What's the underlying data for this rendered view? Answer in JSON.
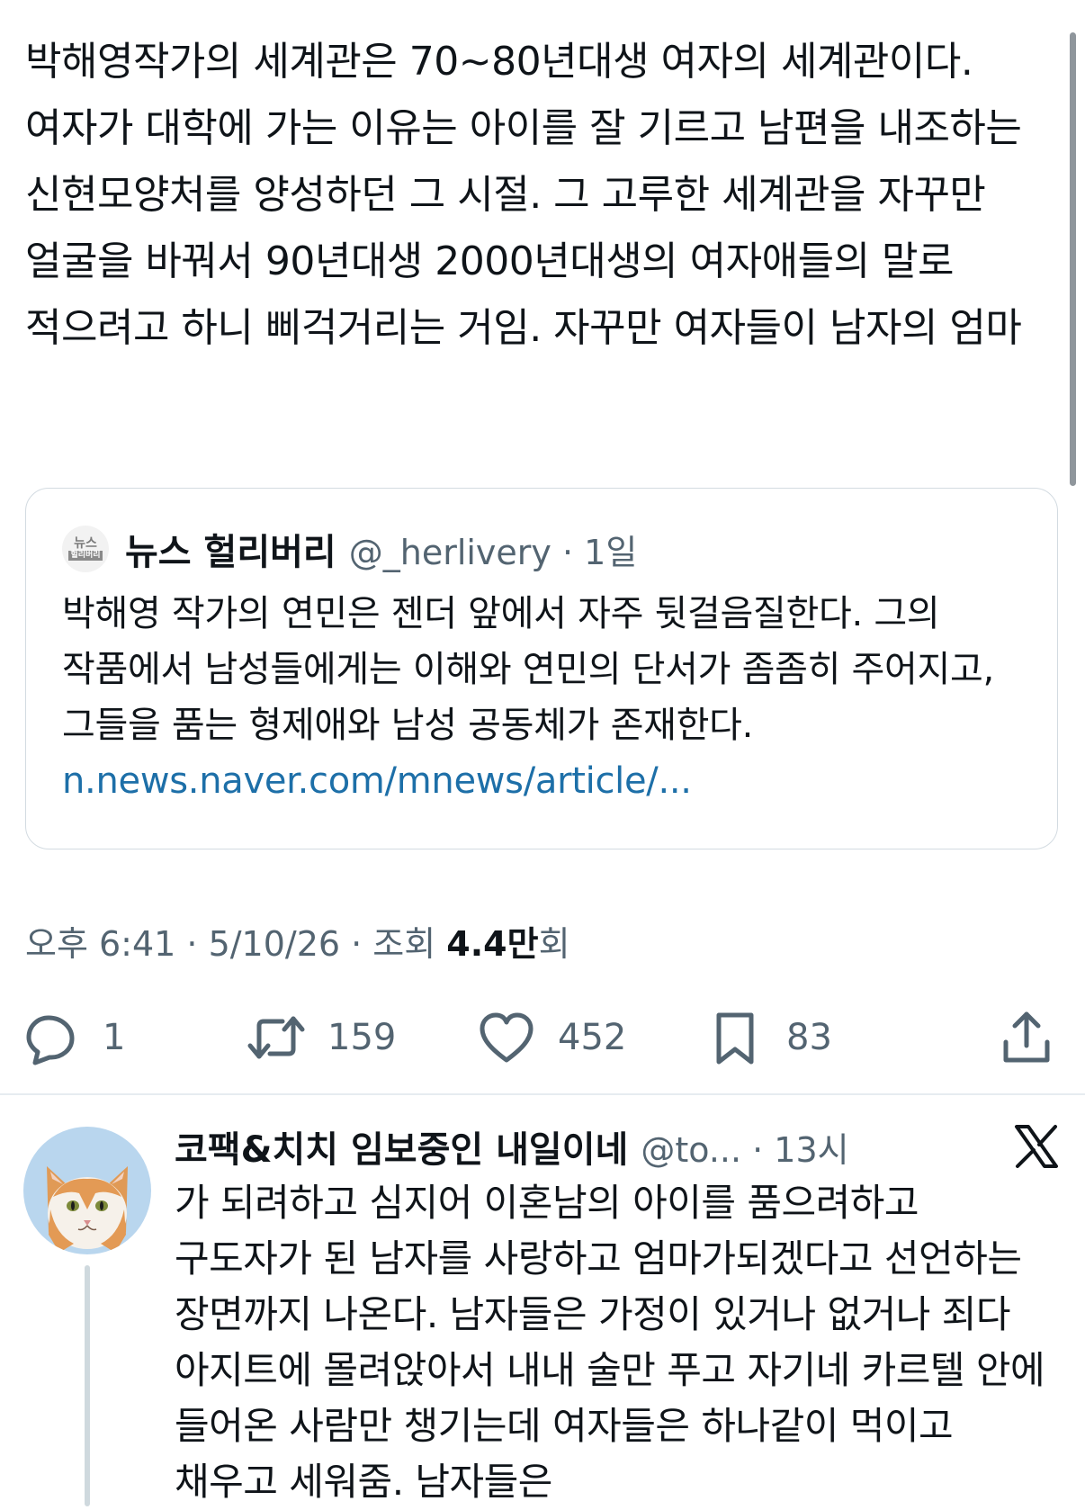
{
  "tweet": {
    "text": "박해영작가의 세계관은 70~80년대생 여자의 세계관이다. 여자가 대학에 가는 이유는 아이를 잘 기르고 남편을 내조하는 신현모양처를 양성하던 그 시절. 그 고루한 세계관을 자꾸만 얼굴을 바꿔서 90년대생 2000년대생의 여자애들의 말로 적으려고 하니 삐걱거리는 거임. 자꾸만 여자들이 남자의 엄마",
    "timestamp": "오후 6:41 · 5/10/26 · 조회 ",
    "views_count": "4.4만",
    "views_suffix": "회"
  },
  "quote": {
    "avatar_text_top": "뉴스",
    "avatar_text_mid": "헐리버리",
    "author_name": "뉴스 헐리버리",
    "handle_time": "@_herlivery · 1일",
    "body": "박해영 작가의 연민은 젠더 앞에서 자주 뒷걸음질한다. 그의 작품에서 남성들에게는 이해와 연민의 단서가 좀좀히 주어지고, 그들을 품는 형제애와 남성 공동체가 존재한다.",
    "link": "n.news.naver.com/mnews/article/..."
  },
  "actions": {
    "reply_count": "1",
    "retweet_count": "159",
    "like_count": "452",
    "bookmark_count": "83"
  },
  "reply": {
    "author_name": "코팩&치치 임보중인 내일이네",
    "handle_time": "@to... · 13시",
    "text": "가 되려하고 심지어 이혼남의 아이를 품으려하고 구도자가 된 남자를 사랑하고 엄마가되겠다고 선언하는 장면까지 나온다. 남자들은 가정이 있거나 없거나 죄다 아지트에 몰려앉아서 내내 술만 푸고 자기네 카르텔 안에 들어온 사람만 챙기는데 여자들은 하나같이 먹이고 채우고 세워줌. 남자들은"
  },
  "colors": {
    "text": "#0f1419",
    "secondary": "#536471",
    "link": "#1d6fa8",
    "border": "#d3dbe1"
  },
  "icons": [
    "reply-icon",
    "retweet-icon",
    "like-icon",
    "bookmark-icon",
    "share-icon",
    "x-logo-icon"
  ]
}
